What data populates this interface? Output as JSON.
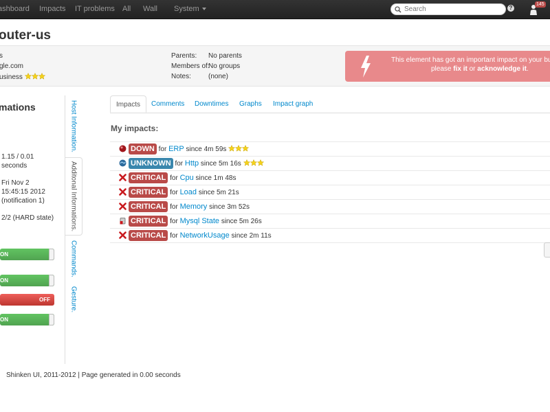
{
  "navbar": {
    "items": [
      "ashboard",
      "Impacts",
      "IT problems",
      "All",
      "Wall"
    ],
    "system_label": "System",
    "search_placeholder": "Search",
    "help_label": "?",
    "notification_count": "145"
  },
  "page": {
    "title": "outer-us"
  },
  "info_band": {
    "left": {
      "line1": "s",
      "line2": "gle.com",
      "line3": "usiness"
    },
    "labels": {
      "parents": "Parents:",
      "members_of": "Members of:",
      "notes": "Notes:"
    },
    "values": {
      "parents": "No parents",
      "members_of": "No groups",
      "notes": "(none)"
    },
    "alert": {
      "line1": "This element has got an important impact on your busi",
      "prefix": "please",
      "fix_link": "fix it",
      "or_text": "or",
      "ack_link": "acknowledge it",
      "suffix": "."
    }
  },
  "left_panel": {
    "heading": "mations",
    "lines": [
      "1.15 / 0.01",
      "seconds",
      "Fri Nov 2",
      "15:45:15 2012",
      "(notification 1)",
      "2/2 (HARD state)"
    ],
    "toggles": [
      {
        "label": "ON",
        "state": "on"
      },
      {
        "label": "ON",
        "state": "on"
      },
      {
        "label": "OFF",
        "state": "off"
      },
      {
        "label": "ON",
        "state": "on"
      }
    ]
  },
  "vertical_tabs": [
    "Host Information.",
    "Additonal Informations.",
    "Commands.",
    "Gesture."
  ],
  "tabs": [
    "Impacts",
    "Comments",
    "Downtimes",
    "Graphs",
    "Impact graph"
  ],
  "impacts_heading": "My impacts:",
  "impacts": [
    {
      "icon": "down-icon",
      "state": "DOWN",
      "state_class": "down",
      "for_text": "for",
      "name": "ERP",
      "since_text": "since 4m 59s",
      "stars": 3
    },
    {
      "icon": "unknown-icon",
      "state": "UNKNOWN",
      "state_class": "unknown",
      "for_text": "for",
      "name": "Http",
      "since_text": "since 5m 16s",
      "stars": 3
    },
    {
      "icon": "critical-icon",
      "state": "CRITICAL",
      "state_class": "critical",
      "for_text": "for",
      "name": "Cpu",
      "since_text": "since 1m 48s",
      "stars": 0
    },
    {
      "icon": "critical-icon",
      "state": "CRITICAL",
      "state_class": "critical",
      "for_text": "for",
      "name": "Load",
      "since_text": "since 5m 21s",
      "stars": 0
    },
    {
      "icon": "critical-icon",
      "state": "CRITICAL",
      "state_class": "critical",
      "for_text": "for",
      "name": "Memory",
      "since_text": "since 3m 52s",
      "stars": 0
    },
    {
      "icon": "database-icon",
      "state": "CRITICAL",
      "state_class": "critical",
      "for_text": "for",
      "name": "Mysql State",
      "since_text": "since 5m 26s",
      "stars": 0
    },
    {
      "icon": "critical-icon",
      "state": "CRITICAL",
      "state_class": "critical",
      "for_text": "for",
      "name": "NetworkUsage",
      "since_text": "since 2m 11s",
      "stars": 0
    }
  ],
  "footer": {
    "text": "Shinken UI, 2011-2012 | Page generated in 0.00 seconds"
  },
  "colors": {
    "navbar": "#222222",
    "link": "#0088cc",
    "critical": "#b94a48",
    "unknown": "#3a87ad",
    "toggle_on": "#51a351",
    "toggle_off": "#bd362f",
    "alert_bg": "#e8898b"
  }
}
